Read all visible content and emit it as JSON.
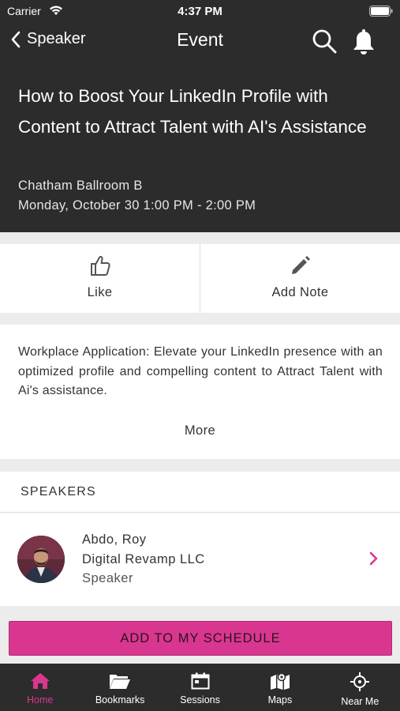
{
  "status": {
    "carrier": "Carrier",
    "time": "4:37 PM"
  },
  "nav": {
    "back_label": "Speaker",
    "title": "Event"
  },
  "event": {
    "title": "How to Boost Your LinkedIn Profile with Content to Attract Talent with AI's Assistance",
    "room": "Chatham Ballroom B",
    "time": "Monday, October 30 1:00 PM - 2:00 PM"
  },
  "actions": {
    "like_label": "Like",
    "note_label": "Add Note"
  },
  "description": {
    "text": "Workplace Application: Elevate your LinkedIn presence with an optimized profile and compelling content to Attract Talent with Ai's assistance.",
    "more_label": "More"
  },
  "speakers": {
    "heading": "SPEAKERS",
    "items": [
      {
        "name": "Abdo, Roy",
        "company": "Digital Revamp LLC",
        "role": "Speaker"
      }
    ]
  },
  "schedule_button": "ADD TO MY SCHEDULE",
  "tabs": [
    {
      "label": "Home",
      "icon": "home-icon",
      "active": true
    },
    {
      "label": "Bookmarks",
      "icon": "folder-icon",
      "active": false
    },
    {
      "label": "Sessions",
      "icon": "calendar-icon",
      "active": false
    },
    {
      "label": "Maps",
      "icon": "map-icon",
      "active": false
    },
    {
      "label": "Near Me",
      "icon": "crosshair-icon",
      "active": false
    }
  ],
  "colors": {
    "accent": "#d9378f",
    "header_bg": "#2c2c2c",
    "page_bg": "#ececec"
  }
}
